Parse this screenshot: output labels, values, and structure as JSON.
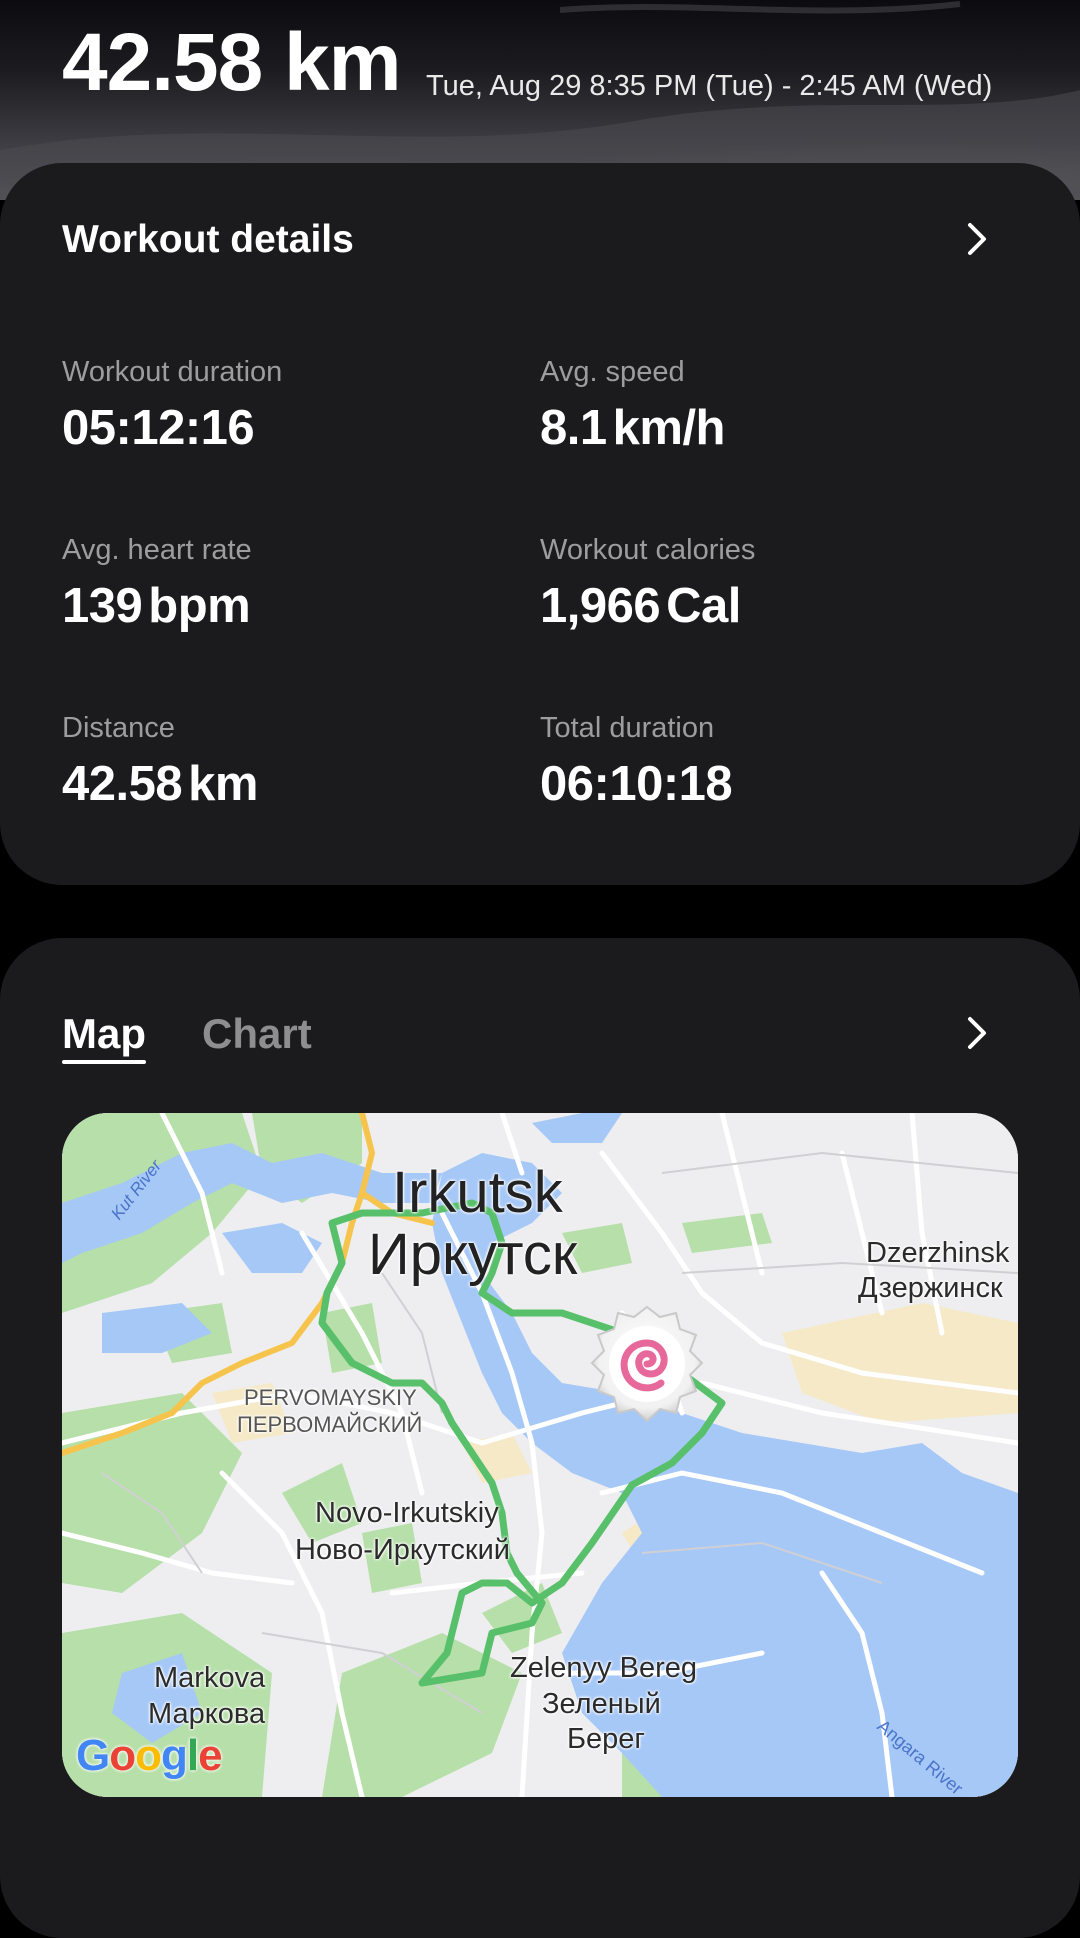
{
  "header": {
    "distance": "42.58 km",
    "date_range": "Tue, Aug 29 8:35 PM (Tue) - 2:45 AM (Wed)"
  },
  "details": {
    "title": "Workout details",
    "stats": [
      {
        "label": "Workout duration",
        "value": "05:12:16",
        "unit": ""
      },
      {
        "label": "Avg. speed",
        "value": "8.1",
        "unit": "km/h"
      },
      {
        "label": "Avg. heart rate",
        "value": "139",
        "unit": "bpm"
      },
      {
        "label": "Workout calories",
        "value": "1,966",
        "unit": "Cal"
      },
      {
        "label": "Distance",
        "value": "42.58",
        "unit": "km"
      },
      {
        "label": "Total duration",
        "value": "06:10:18",
        "unit": ""
      }
    ]
  },
  "map_section": {
    "tabs": [
      {
        "label": "Map",
        "selected": true
      },
      {
        "label": "Chart",
        "selected": false
      }
    ],
    "map": {
      "labels": {
        "irkutsk_latin": "Irkutsk",
        "irkutsk_cyrillic": "Иркутск",
        "dzerzhinsk_latin": "Dzerzhinsk",
        "dzerzhinsk_cyrillic": "Дзержинск",
        "pervomayskiy_latin": "PERVOMAYSKIY",
        "pervomayskiy_cyrillic": "ПЕРВОМАЙСКИЙ",
        "novo_latin": "Novo-Irkutskiy",
        "novo_cyrillic": "Ново-Иркутский",
        "markova_latin": "Markova",
        "markova_cyrillic": "Маркова",
        "zelenyy_latin": "Zelenyy Bereg",
        "zelenyy_cyrillic_1": "Зеленый",
        "zelenyy_cyrillic_2": "Берег",
        "kut_river": "Kut River",
        "angara_river": "Angara River",
        "attribution": "Google"
      },
      "colors": {
        "route": "#58bf6a",
        "water": "#a6c8f7",
        "park": "#b7dfa9",
        "land": "#eeeef0",
        "highway": "#f6c44c",
        "pin_swirl": "#e7699b"
      }
    }
  }
}
